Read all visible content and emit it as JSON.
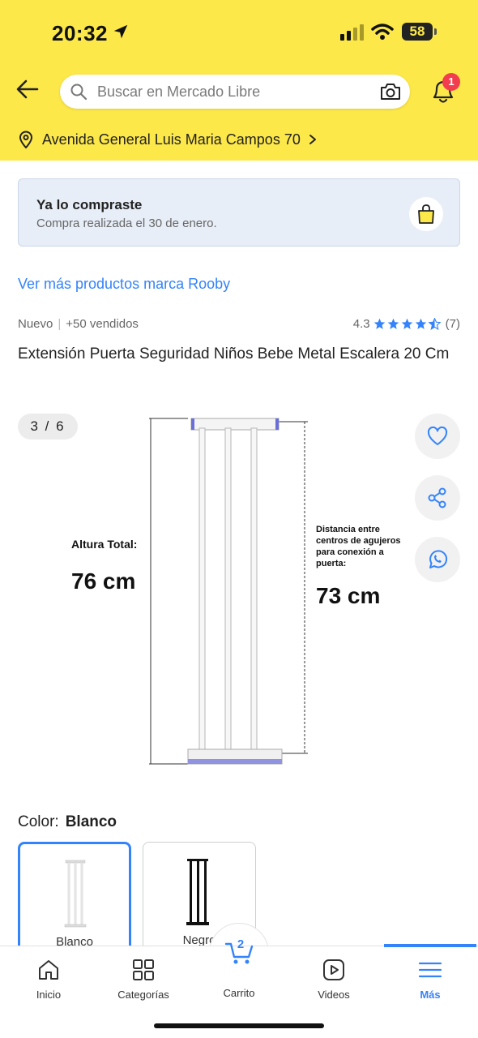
{
  "status_bar": {
    "time": "20:32",
    "battery": "58"
  },
  "header": {
    "search_placeholder": "Buscar en Mercado Libre",
    "notification_count": "1",
    "address": "Avenida General Luis Maria Campos 70"
  },
  "purchase_banner": {
    "title": "Ya lo compraste",
    "subtitle": "Compra realizada el 30 de enero."
  },
  "brand_link": "Ver más productos marca Rooby",
  "product": {
    "condition": "Nuevo",
    "sold": "+50 vendidos",
    "rating": "4.3",
    "rating_stars": 4.3,
    "review_count": "(7)",
    "title": "Extensión Puerta Seguridad Niños Bebe Metal Escalera 20 Cm"
  },
  "gallery": {
    "counter": "3 / 6",
    "image_text": {
      "height_label": "Altura Total:",
      "height_value": "76 cm",
      "distance_label_1": "Distancia entre",
      "distance_label_2": "centros de agujeros",
      "distance_label_3": "para conexión a",
      "distance_label_4": "puerta:",
      "distance_value": "73 cm"
    },
    "actions": [
      "heart-icon",
      "share-icon",
      "whatsapp-icon"
    ]
  },
  "color": {
    "label": "Color:",
    "selected": "Blanco",
    "options": [
      {
        "label": "Blanco"
      },
      {
        "label": "Negro"
      }
    ]
  },
  "tabbar": {
    "items": [
      {
        "label": "Inicio",
        "icon": "home-icon"
      },
      {
        "label": "Categorías",
        "icon": "categories-icon"
      },
      {
        "label": "Carrito",
        "icon": "cart-icon"
      },
      {
        "label": "Videos",
        "icon": "video-icon"
      },
      {
        "label": "Más",
        "icon": "menu-icon"
      }
    ],
    "cart_count": "2",
    "active_index": 4
  },
  "colors": {
    "header_yellow": "#fde84a",
    "brand_blue": "#3483fa",
    "badge_red": "#f23d4f",
    "banner_bg": "#e8eef8"
  }
}
